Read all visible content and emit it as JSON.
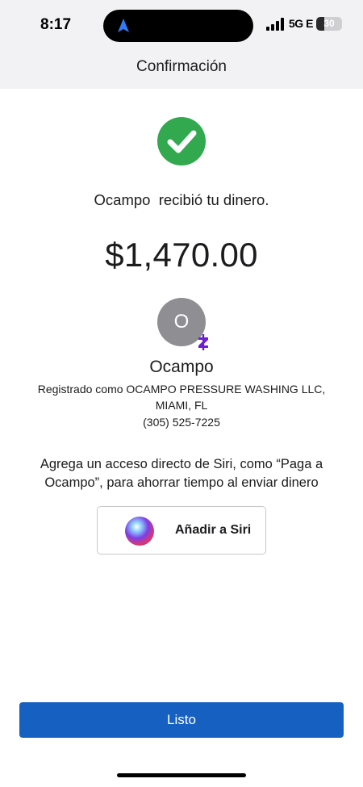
{
  "status_bar": {
    "time": "8:17",
    "network": "5G E",
    "battery_text": "30",
    "battery_level": 0.3,
    "nav_icon": "location-arrow-icon",
    "signal_icon": "cellular-signal-icon"
  },
  "header": {
    "title": "Confirmación"
  },
  "confirmation": {
    "check_icon": "checkmark-circle-icon",
    "message": "Ocampo  recibió tu dinero.",
    "amount": "$1,470.00"
  },
  "recipient": {
    "avatar_letter": "O",
    "badge_icon": "zelle-icon",
    "name": "Ocampo",
    "registered_line1": "Registrado como OCAMPO PRESSURE WASHING LLC,",
    "registered_line2": "MIAMI, FL",
    "phone": "(305) 525-7225"
  },
  "siri": {
    "prompt": "Agrega un acceso directo de Siri, como “Paga a Ocampo”, para ahorrar tiempo al enviar dinero",
    "button_label": "Añadir a Siri",
    "icon": "siri-icon"
  },
  "footer": {
    "done_label": "Listo"
  },
  "colors": {
    "success_green": "#32a94e",
    "primary_blue": "#1660c2",
    "zelle_purple": "#6d1ed4",
    "avatar_gray": "#8e8e93"
  }
}
